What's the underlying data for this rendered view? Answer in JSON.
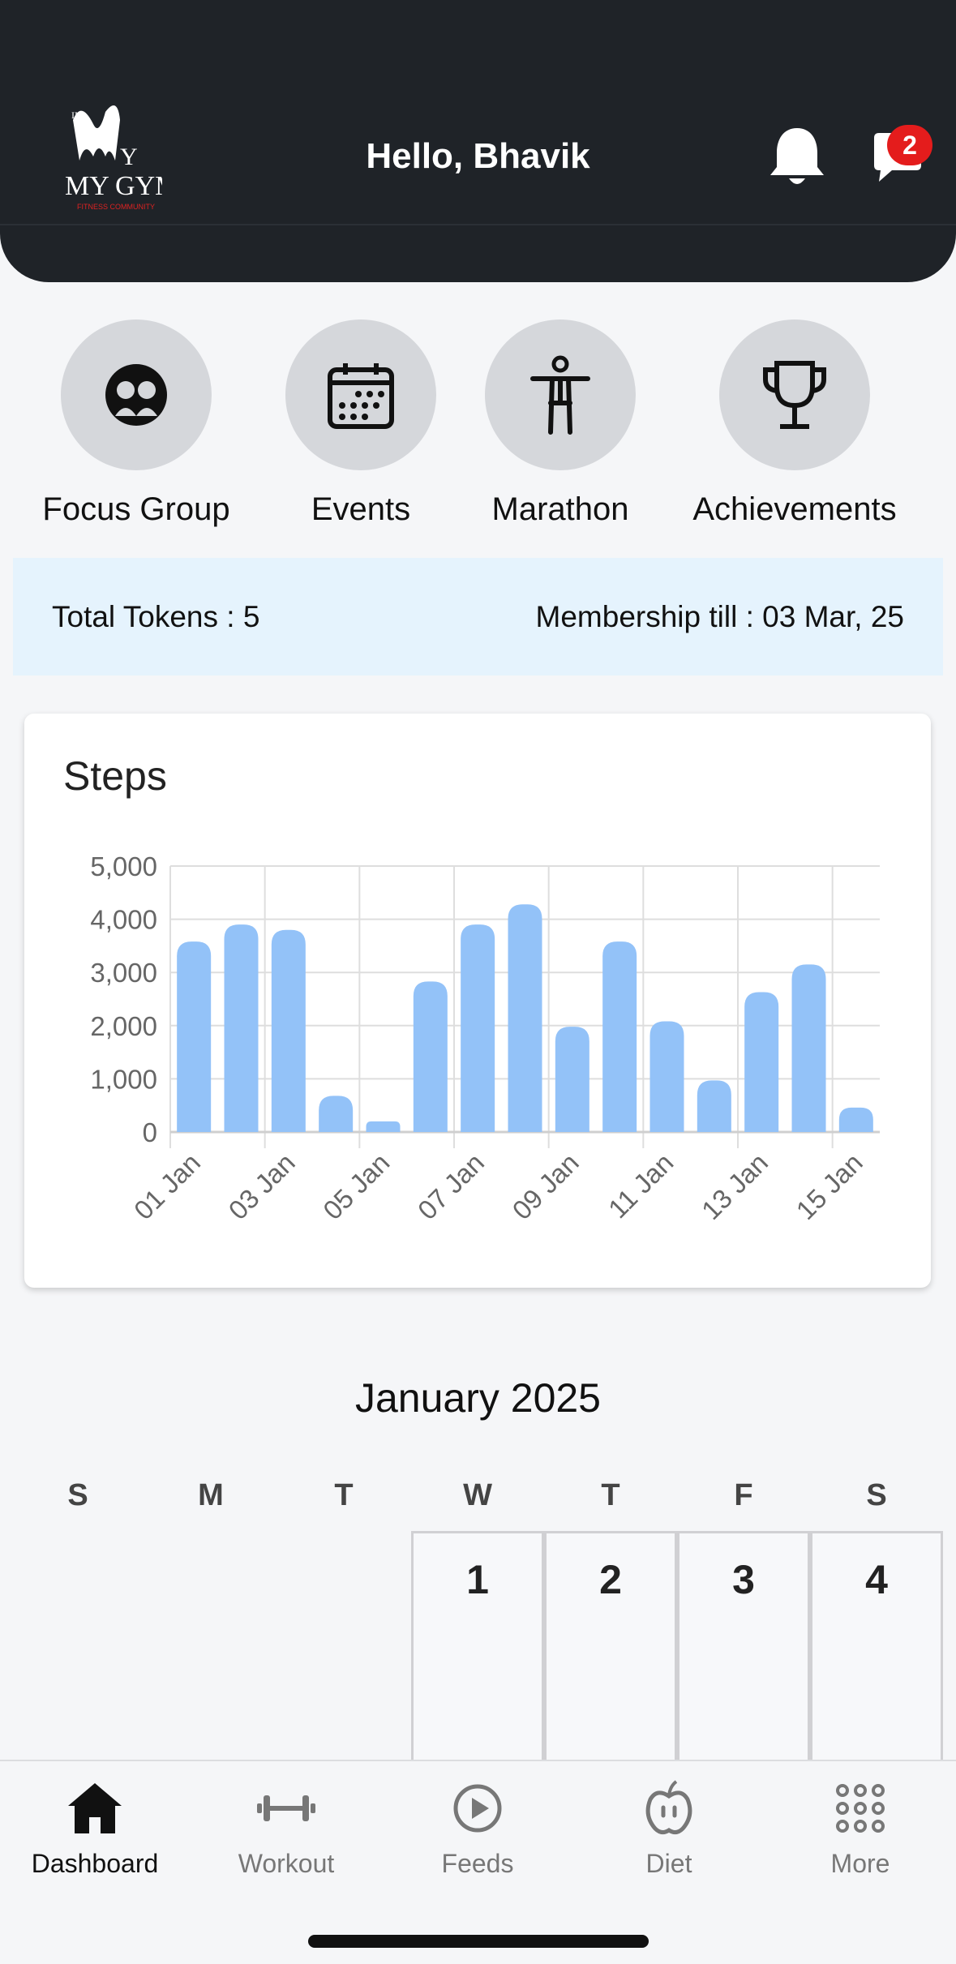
{
  "header": {
    "greeting": "Hello, Bhavik",
    "chat_badge": "2",
    "logo_text": "MY GYM"
  },
  "quick_actions": [
    {
      "label": "Focus Group",
      "icon": "focus-group-icon"
    },
    {
      "label": "Events",
      "icon": "calendar-icon"
    },
    {
      "label": "Marathon",
      "icon": "person-icon"
    },
    {
      "label": "Achievements",
      "icon": "trophy-icon"
    }
  ],
  "tokens": {
    "total": "Total Tokens : 5",
    "membership": "Membership till : 03 Mar, 25"
  },
  "steps_card": {
    "title": "Steps"
  },
  "chart_data": {
    "type": "bar",
    "title": "Steps",
    "categories": [
      "01 Jan",
      "02 Jan",
      "03 Jan",
      "04 Jan",
      "05 Jan",
      "06 Jan",
      "07 Jan",
      "08 Jan",
      "09 Jan",
      "10 Jan",
      "11 Jan",
      "12 Jan",
      "13 Jan",
      "14 Jan",
      "15 Jan"
    ],
    "tick_labels": [
      "01 Jan",
      "03 Jan",
      "05 Jan",
      "07 Jan",
      "09 Jan",
      "11 Jan",
      "13 Jan",
      "15 Jan"
    ],
    "values": [
      3580,
      3900,
      3800,
      680,
      200,
      2830,
      3900,
      4280,
      1980,
      3580,
      2080,
      970,
      2630,
      3150,
      460
    ],
    "y_ticks": [
      "0",
      "1,000",
      "2,000",
      "3,000",
      "4,000",
      "5,000"
    ],
    "ylim": [
      0,
      5000
    ],
    "bar_color": "#93c2f8",
    "grid": true
  },
  "calendar": {
    "month": "January 2025",
    "weekdays": [
      "S",
      "M",
      "T",
      "W",
      "T",
      "F",
      "S"
    ],
    "days": [
      "1",
      "2",
      "3",
      "4"
    ]
  },
  "nav": [
    {
      "label": "Dashboard",
      "icon": "home-icon",
      "active": true
    },
    {
      "label": "Workout",
      "icon": "dumbbell-icon",
      "active": false
    },
    {
      "label": "Feeds",
      "icon": "play-icon",
      "active": false
    },
    {
      "label": "Diet",
      "icon": "apple-icon",
      "active": false
    },
    {
      "label": "More",
      "icon": "grid-icon",
      "active": false
    }
  ]
}
